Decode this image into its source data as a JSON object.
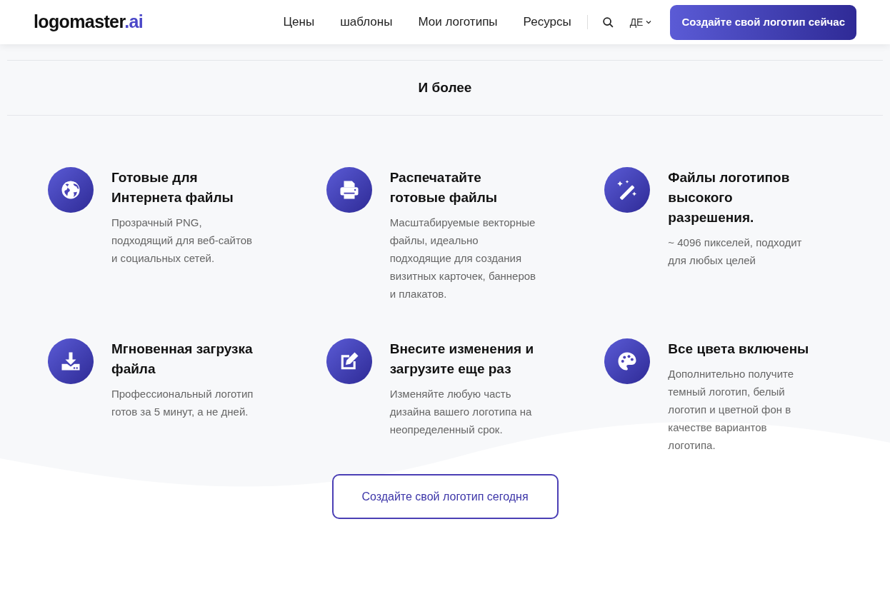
{
  "header": {
    "logo": {
      "name": "logomaster",
      "suffix": ".ai"
    },
    "nav": [
      "Цены",
      "шаблоны",
      "Мои логотипы",
      "Ресурсы"
    ],
    "language": "ДЕ",
    "cta": "Создайте свой логотип сейчас"
  },
  "section": {
    "title": "И более",
    "features": [
      {
        "kind": "globe",
        "title": "Готовые для Интернета файлы",
        "description": "Прозрачный PNG, подходящий для веб-сайтов и социальных сетей."
      },
      {
        "kind": "printer",
        "title": "Распечатайте готовые файлы",
        "description": "Масштабируемые векторные файлы, идеально подходящие для создания визитных карточек, баннеров и плакатов."
      },
      {
        "kind": "wand",
        "title": "Файлы логотипов высокого разрешения.",
        "description": "~ 4096 пикселей, подходит для любых целей"
      },
      {
        "kind": "download",
        "title": "Мгновенная загрузка файла",
        "description": "Профессиональный логотип готов за 5 минут, а не дней."
      },
      {
        "kind": "edit",
        "title": "Внесите изменения и загрузите еще раз",
        "description": "Изменяйте любую часть дизайна вашего логотипа на неопределенный срок."
      },
      {
        "kind": "palette",
        "title": "Все цвета включены",
        "description": "Дополнительно получите темный логотип, белый логотип и цветной фон в качестве вариантов логотипа."
      }
    ],
    "button": "Создайте свой логотип сегодня"
  }
}
